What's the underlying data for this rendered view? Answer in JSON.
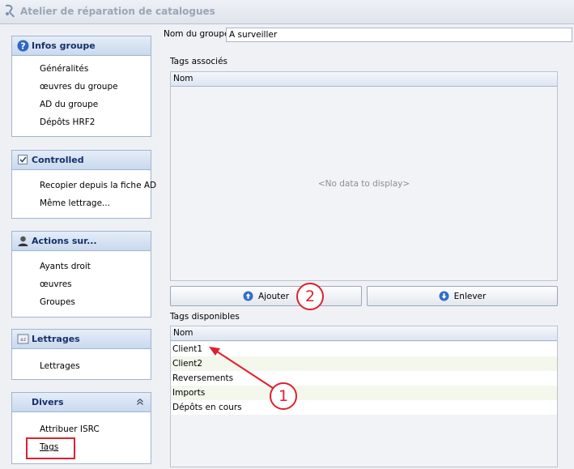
{
  "window": {
    "title": "Atelier de réparation de catalogues"
  },
  "sidebar": {
    "groups": [
      {
        "title": "Infos groupe",
        "icon": "help-icon",
        "items": [
          "Généralités",
          "œuvres du groupe",
          "AD du groupe",
          "Dépôts HRF2"
        ]
      },
      {
        "title": "Controlled",
        "icon": "checkbox-icon",
        "items": [
          "Recopier depuis la fiche AD",
          "Même lettrage..."
        ]
      },
      {
        "title": "Actions sur...",
        "icon": "person-icon",
        "items": [
          "Ayants droit",
          "œuvres",
          "Groupes"
        ]
      },
      {
        "title": "Lettrages",
        "icon": "lettrage-icon",
        "items": [
          "Lettrages"
        ]
      },
      {
        "title": "Divers",
        "icon": "chevron-up-icon",
        "items": [
          "Attribuer ISRC",
          "Tags"
        ]
      }
    ]
  },
  "main": {
    "group_name_label": "Nom du groupe",
    "group_name_value": "A surveiller",
    "associated_tags": {
      "label": "Tags associés",
      "column": "Nom",
      "empty_text": "<No data to display>"
    },
    "buttons": {
      "add": "Ajouter",
      "remove": "Enlever"
    },
    "available_tags": {
      "label": "Tags disponibles",
      "column": "Nom",
      "rows": [
        "Client1",
        "Client2",
        "Reversements",
        "Imports",
        "Dépôts en cours"
      ]
    }
  },
  "annotations": {
    "callout_1": "1",
    "callout_2": "2"
  },
  "colors": {
    "annotation": "#e0202e",
    "header_text": "#15306a"
  }
}
